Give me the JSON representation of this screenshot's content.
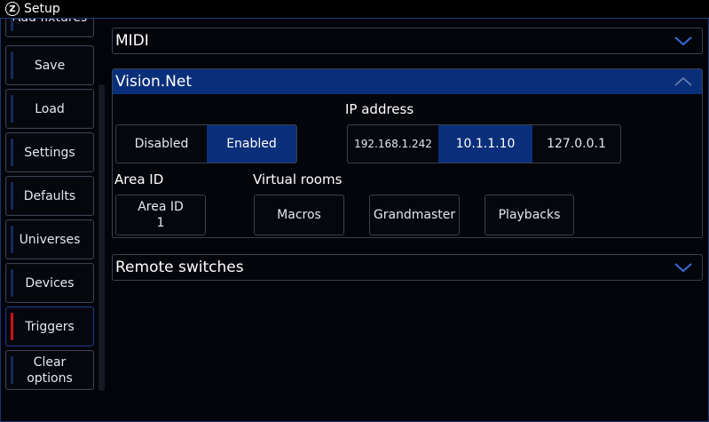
{
  "window": {
    "title": "Setup",
    "logo_letter": "Z"
  },
  "sidebar": {
    "items": [
      {
        "label": "Add fixtures",
        "active": false
      },
      {
        "label": "Save",
        "active": false
      },
      {
        "label": "Load",
        "active": false
      },
      {
        "label": "Settings",
        "active": false
      },
      {
        "label": "Defaults",
        "active": false
      },
      {
        "label": "Universes",
        "active": false
      },
      {
        "label": "Devices",
        "active": false
      },
      {
        "label": "Triggers",
        "active": true
      },
      {
        "label": "Clear\noptions",
        "active": false
      }
    ]
  },
  "sections": {
    "midi": {
      "title": "MIDI",
      "expanded": false
    },
    "visionnet": {
      "title": "Vision.Net",
      "expanded": true,
      "mode": {
        "options": [
          "Disabled",
          "Enabled"
        ],
        "selected": "Enabled"
      },
      "ip": {
        "label": "IP address",
        "options": [
          "192.168.1.242",
          "10.1.1.10",
          "127.0.0.1"
        ],
        "selected": "10.1.1.10"
      },
      "area": {
        "label": "Area ID",
        "button_line1": "Area ID",
        "button_line2": "1"
      },
      "virtual_rooms": {
        "label": "Virtual rooms",
        "buttons": [
          "Macros",
          "Grandmaster",
          "Playbacks"
        ]
      }
    },
    "remote": {
      "title": "Remote switches",
      "expanded": false
    }
  },
  "colors": {
    "accent": "#0a2f7a",
    "active_marker": "#c8141c",
    "border": "#3a4150"
  }
}
